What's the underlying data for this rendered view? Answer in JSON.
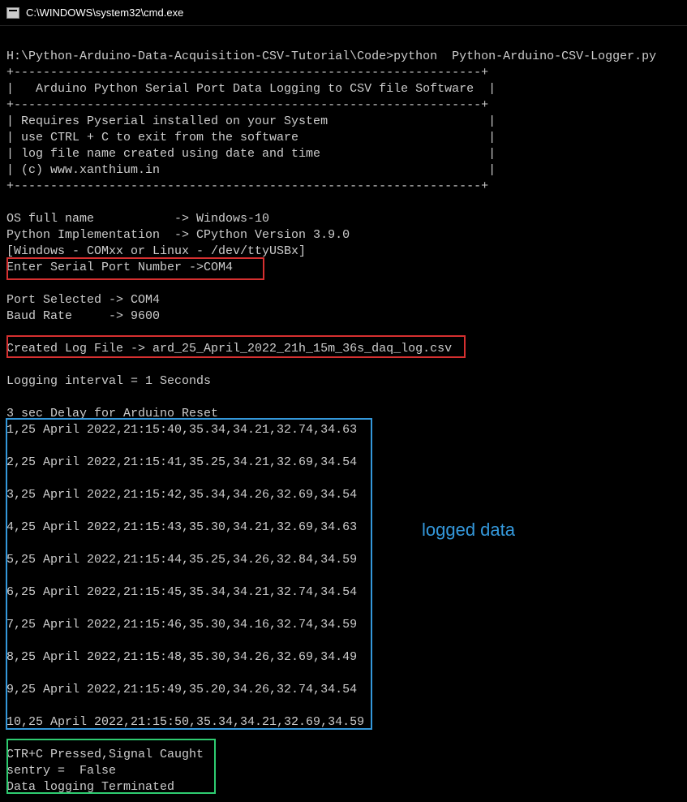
{
  "window": {
    "title": "C:\\WINDOWS\\system32\\cmd.exe"
  },
  "terminal": {
    "prompt": "H:\\Python-Arduino-Data-Acquisition-CSV-Tutorial\\Code>python  Python-Arduino-CSV-Logger.py",
    "header_border": "+----------------------------------------------------------------+",
    "header_title": "|   Arduino Python Serial Port Data Logging to CSV file Software  |",
    "info_line1": "| Requires Pyserial installed on your System                      |",
    "info_line2": "| use CTRL + C to exit from the software                          |",
    "info_line3": "| log file name created using date and time                       |",
    "info_line4": "| (c) www.xanthium.in                                             |",
    "os_line": "OS full name           -> Windows-10",
    "python_line": "Python Implementation  -> CPython Version 3.9.0",
    "port_hint": "[Windows - COMxx or Linux - /dev/ttyUSBx]",
    "enter_port": "Enter Serial Port Number ->COM4",
    "port_selected": "Port Selected -> COM4",
    "baud_rate": "Baud Rate     -> 9600",
    "log_file": "Created Log File -> ard_25_April_2022_21h_15m_36s_daq_log.csv",
    "logging_interval": "Logging interval = 1 Seconds",
    "delay_msg": "3 sec Delay for Arduino Reset",
    "data_rows": [
      "1,25 April 2022,21:15:40,35.34,34.21,32.74,34.63",
      "2,25 April 2022,21:15:41,35.25,34.21,32.69,34.54",
      "3,25 April 2022,21:15:42,35.34,34.26,32.69,34.54",
      "4,25 April 2022,21:15:43,35.30,34.21,32.69,34.63",
      "5,25 April 2022,21:15:44,35.25,34.26,32.84,34.59",
      "6,25 April 2022,21:15:45,35.34,34.21,32.74,34.54",
      "7,25 April 2022,21:15:46,35.30,34.16,32.74,34.59",
      "8,25 April 2022,21:15:48,35.30,34.26,32.69,34.49",
      "9,25 April 2022,21:15:49,35.20,34.26,32.74,34.54",
      "10,25 April 2022,21:15:50,35.34,34.21,32.69,34.59"
    ],
    "ctrlc_line1": "CTR+C Pressed,Signal Caught",
    "ctrlc_line2": "sentry =  False",
    "ctrlc_line3": "Data logging Terminated"
  },
  "annotations": {
    "logged_data": "logged data"
  }
}
